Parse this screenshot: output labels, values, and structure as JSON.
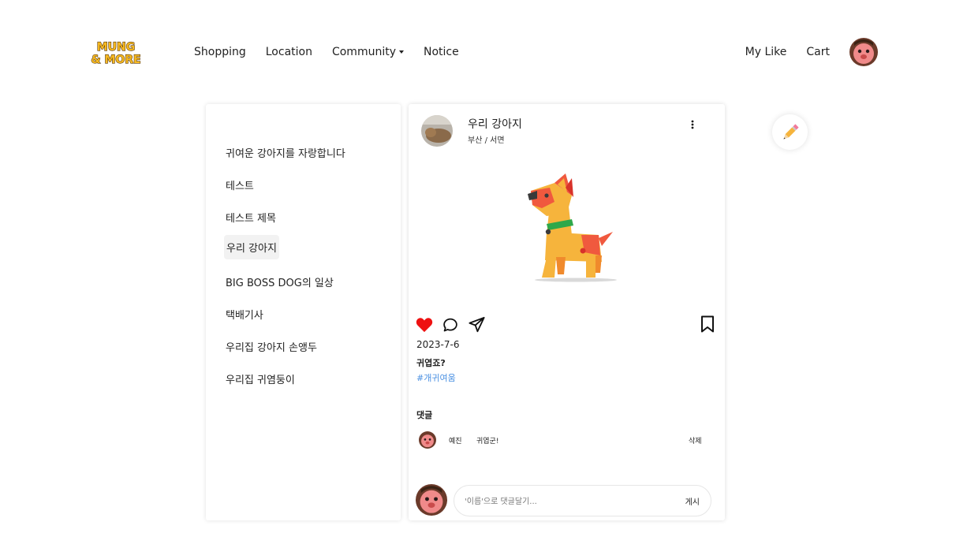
{
  "logo": {
    "line1": "MUNG",
    "line2": "& MORE"
  },
  "nav": {
    "links": [
      "Shopping",
      "Location",
      "Community",
      "Notice"
    ],
    "right": [
      "My Like",
      "Cart"
    ]
  },
  "sidebar": {
    "items": [
      "귀여운 강아지를 자랑합니다",
      "테스트",
      "테스트 제목",
      "우리 강아지",
      "BIG BOSS DOG의 일상",
      "택배기사",
      "우리집 강아지 손앵두",
      "우리집 귀염둥이"
    ],
    "active_index": 3
  },
  "post": {
    "author": "우리 강아지",
    "location": "부산 / 서면",
    "date": "2023-7-6",
    "caption": "귀엽죠?",
    "tag": "#개귀여움",
    "liked": true
  },
  "comments": {
    "title": "댓글",
    "items": [
      {
        "name": "예진",
        "text": "귀엽군!",
        "delete_label": "삭제"
      }
    ],
    "input_placeholder": "'이름'으로 댓글달기...",
    "submit_label": "게시"
  },
  "colors": {
    "heart": "#ee1111",
    "tag": "#4a90e2",
    "logo_fill": "#f6b921"
  },
  "icons": [
    "more-icon",
    "heart-icon",
    "comment-icon",
    "share-icon",
    "bookmark-icon",
    "pencil-icon"
  ]
}
